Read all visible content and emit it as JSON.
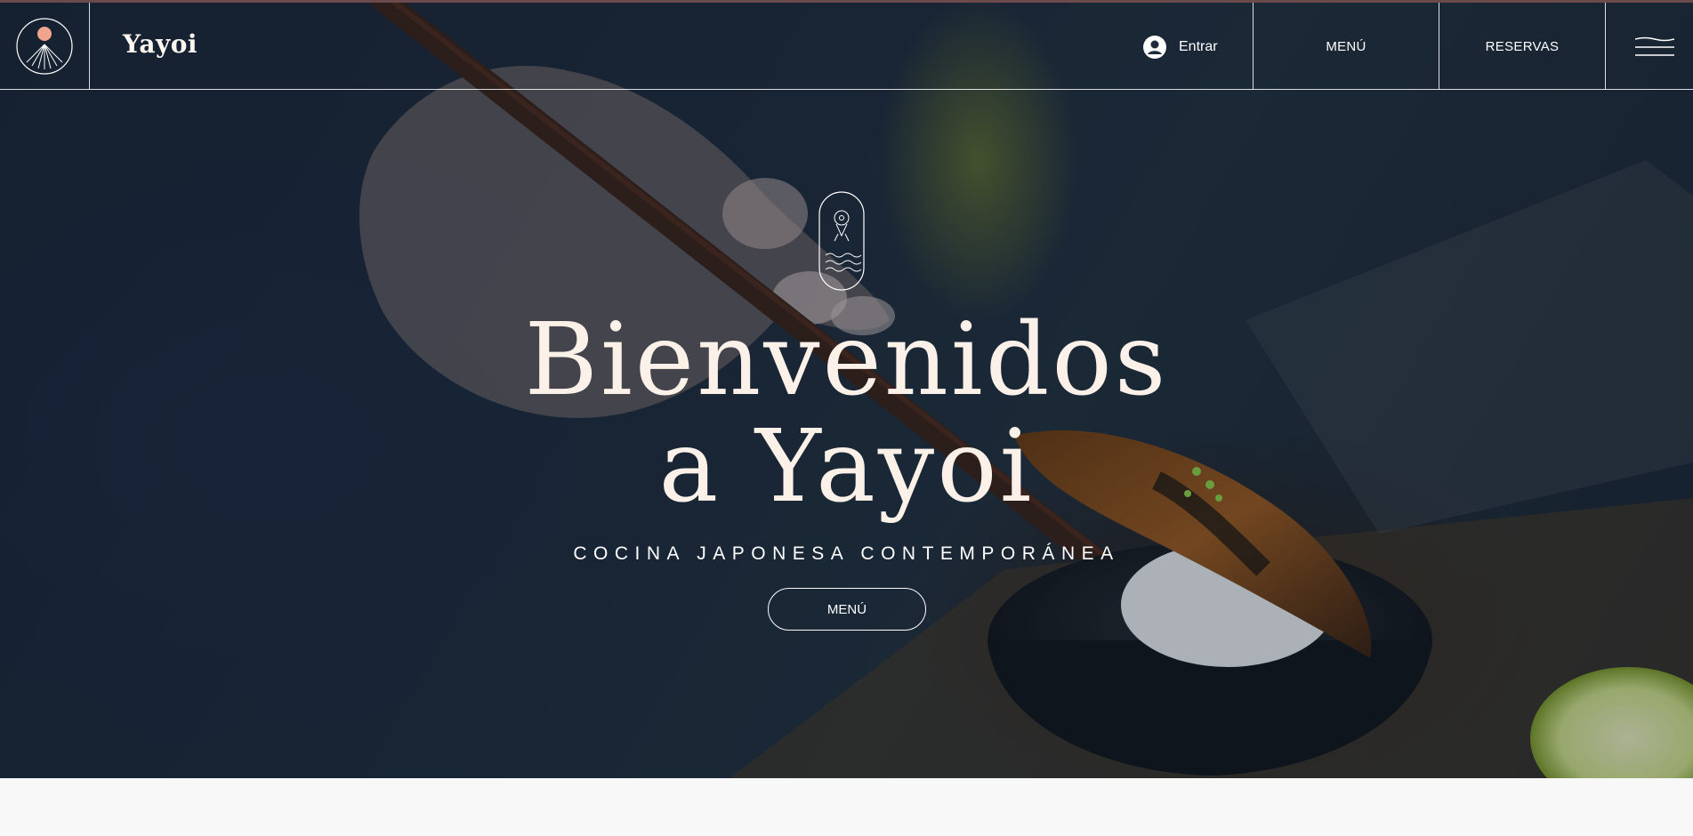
{
  "brand": {
    "name": "Yayoi"
  },
  "header": {
    "login_label": "Entrar",
    "nav": [
      {
        "label": "MENÚ"
      },
      {
        "label": "RESERVAS"
      }
    ],
    "menu_icon": "hamburger-menu-icon"
  },
  "hero": {
    "title_line1": "Bienvenidos",
    "title_line2": "a Yayoi",
    "subtitle": "COCINA JAPONESA CONTEMPORÁNEA",
    "cta_label": "MENÚ",
    "badge_icon": "fish-waves-icon"
  },
  "colors": {
    "accent_sun": "#f0a38d",
    "text_light": "#fbf1e8",
    "hero_bg": "#1d2a3c",
    "footer_bg": "#f8f8f8"
  }
}
